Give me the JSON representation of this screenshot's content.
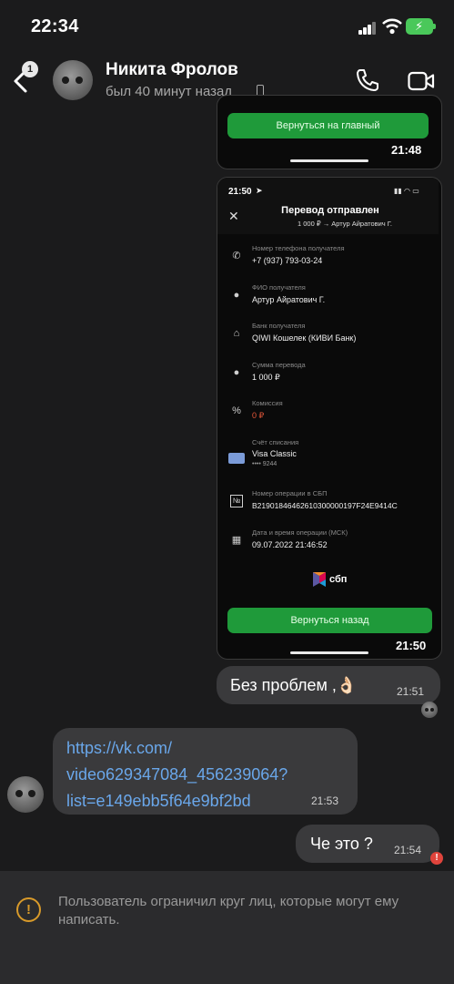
{
  "status_bar": {
    "time": "22:34"
  },
  "header": {
    "back_badge": "1",
    "contact_name": "Никита Фролов",
    "last_seen": "был 40 минут назад"
  },
  "messages": {
    "shot1": {
      "button_label": "Вернуться на главный",
      "time": "21:48"
    },
    "shot2": {
      "phone_time": "21:50",
      "title": "Перевод отправлен",
      "subtitle": "1 000 ₽ → Артур Айратович Г.",
      "rows": [
        {
          "label": "Номер телефона получателя",
          "value": "+7 (937) 793-03-24",
          "icon": "phone-icon"
        },
        {
          "label": "ФИО получателя",
          "value": "Артур Айратович Г.",
          "icon": "person-icon"
        },
        {
          "label": "Банк получателя",
          "value": "QIWI Кошелек (КИВИ Банк)",
          "icon": "bank-icon"
        },
        {
          "label": "Сумма перевода",
          "value": "1 000 ₽",
          "icon": "money-bag-icon"
        },
        {
          "label": "Комиссия",
          "value": "0 ₽",
          "icon": "percent-icon"
        },
        {
          "label": "Счёт списания",
          "value": "Visa Classic",
          "value2": "•••• 9244",
          "icon": "card-icon"
        },
        {
          "label": "Номер операции в СБП",
          "value": "B21901846462610300000197F24E9414C",
          "icon": "operation-icon"
        },
        {
          "label": "Дата и время операции (МСК)",
          "value": "09.07.2022 21:46:52",
          "icon": "calendar-icon"
        }
      ],
      "logo_text": "сбп",
      "button_label": "Вернуться назад",
      "time": "21:50"
    },
    "msg_no_problem": {
      "text": "Без проблем ,👌🏻",
      "time": "21:51"
    },
    "msg_link": {
      "lines": [
        "https://vk.com/",
        "video629347084_456239064?",
        "list=e149ebb5f64e9bf2bd"
      ],
      "time": "21:53"
    },
    "msg_what": {
      "text": "Че это ?",
      "time": "21:54",
      "error_mark": "!"
    }
  },
  "footer": {
    "notice": "Пользователь ограничил круг лиц, которые могут ему написать."
  },
  "colors": {
    "accent_green": "#1f9a3a",
    "link_blue": "#6aa7ea",
    "warning": "#d89a2a",
    "error": "#e0443c",
    "bubble": "#3a3a3c"
  }
}
